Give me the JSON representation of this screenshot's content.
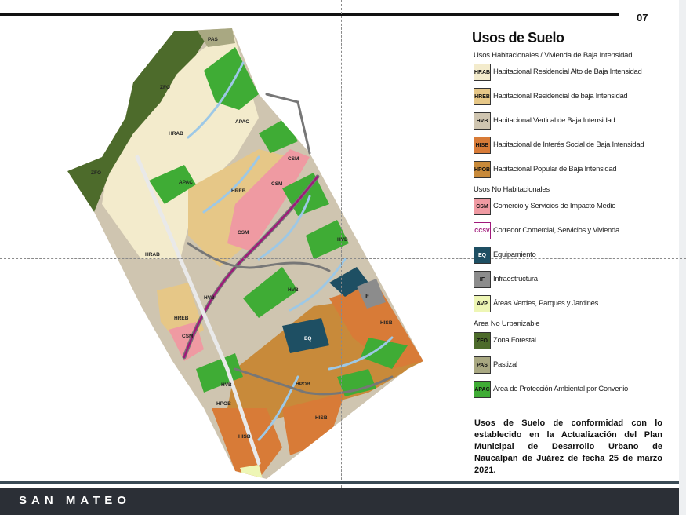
{
  "page_number": "07",
  "map": {
    "labels": {
      "pas": "PAS",
      "zfo": "ZFO",
      "hrab": "HRAB",
      "apac": "APAC",
      "hreb": "HREB",
      "csm": "CSM",
      "hvb": "HVB",
      "eq": "EQ",
      "if": "IF",
      "hisb": "HISB",
      "hpob": "HPOB"
    },
    "colors": {
      "hrab": "#f3ebcc",
      "hreb": "#e6c787",
      "hvb": "#cfc5b0",
      "hisb": "#d87b37",
      "hpob": "#c88a3a",
      "csm": "#ef9aa2",
      "ccsv": "#a0187a",
      "eq": "#1e4f63",
      "if": "#8c8c8c",
      "avp": "#eef6b5",
      "zfo": "#4d6b2b",
      "pas": "#a9a882",
      "apac": "#3fac35",
      "stream": "#9dc8e6",
      "road": "#777777"
    }
  },
  "legend": {
    "title": "Usos de Suelo",
    "groups": [
      {
        "title": "Usos Habitacionales / Vivienda de Baja Intensidad",
        "items": [
          {
            "code": "HRAB",
            "label": "Habitacional Residencial Alto de Baja Intensidad",
            "color": "#f3ebcc"
          },
          {
            "code": "HREB",
            "label": "Habitacional Residencial de baja Intensidad",
            "color": "#e6c787"
          },
          {
            "code": "HVB",
            "label": "Habitacional Vertical de Baja Intensidad",
            "color": "#cfc5b0"
          },
          {
            "code": "HISB",
            "label": "Habitacional de Interés Social de Baja Intensidad",
            "color": "#d87b37"
          },
          {
            "code": "HPOB",
            "label": "Habitacional Popular de Baja Intensidad",
            "color": "#c88a3a"
          }
        ]
      },
      {
        "title": "Usos No Habitacionales",
        "items": [
          {
            "code": "CSM",
            "label": "Comercio y Servicios de Impacto Medio",
            "color": "#ef9aa2"
          },
          {
            "code": "CCSV",
            "label": "Corredor Comercial, Servicios y Vivienda",
            "color": "#ffffff"
          },
          {
            "code": "EQ",
            "label": "Equipamiento",
            "color": "#1e4f63"
          },
          {
            "code": "IF",
            "label": "Infraestructura",
            "color": "#8c8c8c"
          },
          {
            "code": "AVP",
            "label": "Áreas Verdes, Parques y Jardines",
            "color": "#eef6b5"
          }
        ]
      },
      {
        "title": "Área No Urbanizable",
        "items": [
          {
            "code": "ZFO",
            "label": "Zona Forestal",
            "color": "#4d6b2b"
          },
          {
            "code": "PAS",
            "label": "Pastizal",
            "color": "#a9a882"
          },
          {
            "code": "APAC",
            "label": "Área de Protección Ambiental por Convenio",
            "color": "#3fac35"
          }
        ]
      }
    ]
  },
  "note": "Usos de Suelo de conformidad con lo establecido en la Actualización del Plan Municipal de Desarrollo Urbano de Naucalpan de Juárez de fecha 25 de marzo 2021.",
  "footer": "SAN MATEO"
}
